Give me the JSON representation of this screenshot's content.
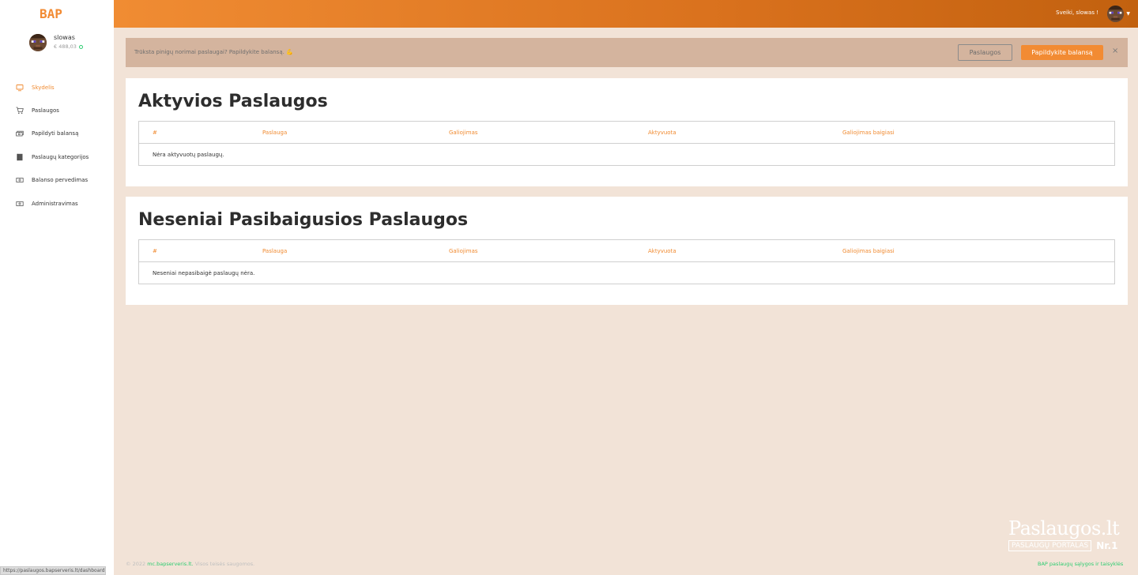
{
  "brand": {
    "logo_text": "BAP",
    "accent": "#f08a30"
  },
  "user": {
    "name": "slowas",
    "balance": "€ 488,03"
  },
  "header": {
    "greeting": "Sveiki, slowas !"
  },
  "sidebar": {
    "items": [
      {
        "label": "Skydelis",
        "icon": "monitor-icon",
        "active": true
      },
      {
        "label": "Paslaugos",
        "icon": "cart-icon"
      },
      {
        "label": "Papildyti balansą",
        "icon": "money-icon"
      },
      {
        "label": "Paslaugų kategorijos",
        "icon": "book-icon"
      },
      {
        "label": "Balanso pervedimas",
        "icon": "transfer-icon"
      },
      {
        "label": "Administravimas",
        "icon": "admin-icon"
      }
    ]
  },
  "alert": {
    "text": "Trūksta pinigų norimai paslaugai? Papildykite balansą. 💪",
    "btn_services": "Paslaugos",
    "btn_topup": "Papildykite balansą",
    "close": "×"
  },
  "active_services": {
    "title": "Aktyvios Paslaugos",
    "columns": [
      "#",
      "Paslauga",
      "Galiojimas",
      "Aktyvuota",
      "Galiojimas baigiasi"
    ],
    "empty": "Nėra aktyvuotų paslaugų."
  },
  "expired_services": {
    "title": "Neseniai Pasibaigusios Paslaugos",
    "columns": [
      "#",
      "Paslauga",
      "Galiojimas",
      "Aktyvuota",
      "Galiojimas baigiasi"
    ],
    "empty": "Neseniai nepasibaigė paslaugų nėra."
  },
  "footer": {
    "copyright_prefix": "© 2022",
    "site_link": "mc.bapserveris.lt.",
    "rights": "Visos teisės saugomos.",
    "terms_link": "BAP paslaugų sąlygos ir taisyklės"
  },
  "watermark": {
    "title": "Paslaugos.lt",
    "subtitle": "PASLAUGŲ PORTALAS",
    "badge": "Nr.1"
  },
  "status_url": "https://paslaugos.bapserveris.lt/dashboard"
}
